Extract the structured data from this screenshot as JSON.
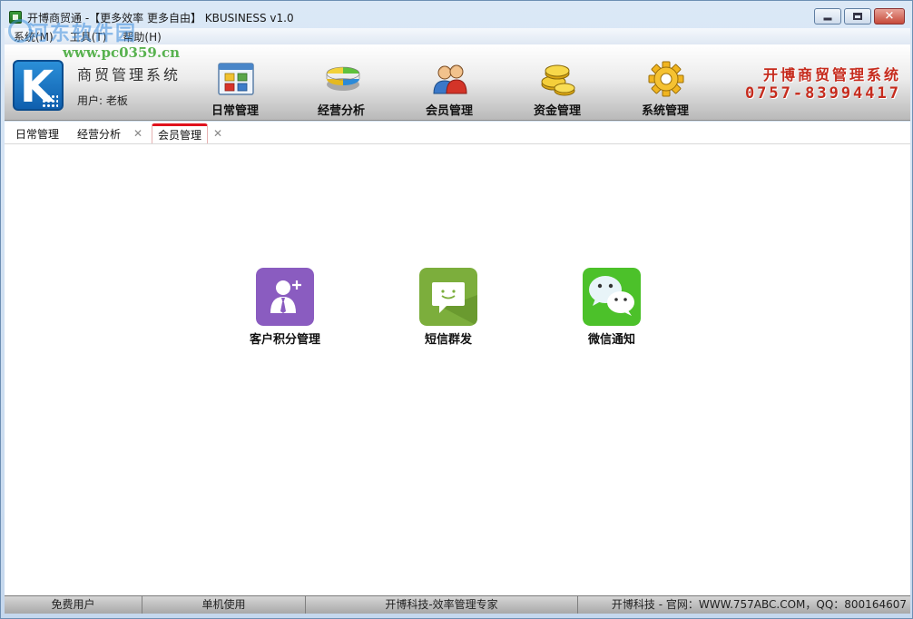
{
  "window": {
    "title": "开博商贸通 -【更多效率 更多自由】  KBUSINESS v1.0"
  },
  "watermark": {
    "site_name": "河东软件园",
    "url": "www.pc0359.cn"
  },
  "menubar": {
    "items": [
      {
        "label": "系统(M)"
      },
      {
        "label": "工具(T)"
      },
      {
        "label": "帮助(H)"
      }
    ]
  },
  "header": {
    "logo_letter": "K",
    "system_name": "商贸管理系统",
    "user_label": "用户: 老板",
    "nav": [
      {
        "label": "日常管理",
        "icon": "window-grid-icon"
      },
      {
        "label": "经营分析",
        "icon": "pie-chart-icon"
      },
      {
        "label": "会员管理",
        "icon": "users-icon"
      },
      {
        "label": "资金管理",
        "icon": "coins-icon"
      },
      {
        "label": "系统管理",
        "icon": "gear-icon"
      }
    ],
    "company_name": "开博商贸管理系统",
    "company_phone": "0757-83994417"
  },
  "tabs": [
    {
      "label": "日常管理",
      "closable": false,
      "active": false
    },
    {
      "label": "经营分析",
      "closable": true,
      "active": false
    },
    {
      "label": "会员管理",
      "closable": true,
      "active": true
    }
  ],
  "tab_close_glyph": "✕",
  "functions": [
    {
      "label": "客户积分管理",
      "icon": "add-customer-icon",
      "color": "#8a5cc0"
    },
    {
      "label": "短信群发",
      "icon": "sms-icon",
      "color": "#7cae3c"
    },
    {
      "label": "微信通知",
      "icon": "wechat-icon",
      "color": "#4cc12a"
    }
  ],
  "statusbar": {
    "cells": [
      {
        "text": "免费用户"
      },
      {
        "text": "单机使用"
      },
      {
        "text": "开博科技-效率管理专家"
      },
      {
        "text": "开博科技 - 官网：WWW.757ABC.COM，QQ：800164607"
      }
    ]
  },
  "colors": {
    "accent_red": "#c62b1d",
    "active_tab_border": "#e0121d",
    "logo_blue": "#1f7cc8"
  }
}
